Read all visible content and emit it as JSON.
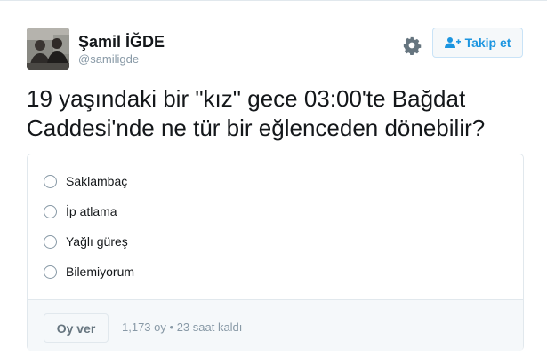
{
  "author": {
    "display_name": "Şamil İĞDE",
    "handle": "@samiligde",
    "avatar_icon": "profile-photo"
  },
  "actions": {
    "settings_icon": "gear-icon",
    "follow_icon": "add-user-icon",
    "follow_label": "Takip et"
  },
  "tweet": {
    "text": "19 yaşındaki bir \"kız\" gece 03:00'te Bağdat Caddesi'nde ne tür bir eğlenceden dönebilir?"
  },
  "poll": {
    "options": [
      {
        "label": "Saklambaç"
      },
      {
        "label": "İp atlama"
      },
      {
        "label": "Yağlı güreş"
      },
      {
        "label": "Bilemiyorum"
      }
    ],
    "vote_label": "Oy ver",
    "vote_count": "1,173 oy",
    "separator": "•",
    "time_left": "23 saat kaldı"
  },
  "colors": {
    "accent": "#1b95e0",
    "text": "#14171a",
    "muted": "#8899a6",
    "border": "#e1e8ed",
    "background_light": "#f5f8fa"
  }
}
